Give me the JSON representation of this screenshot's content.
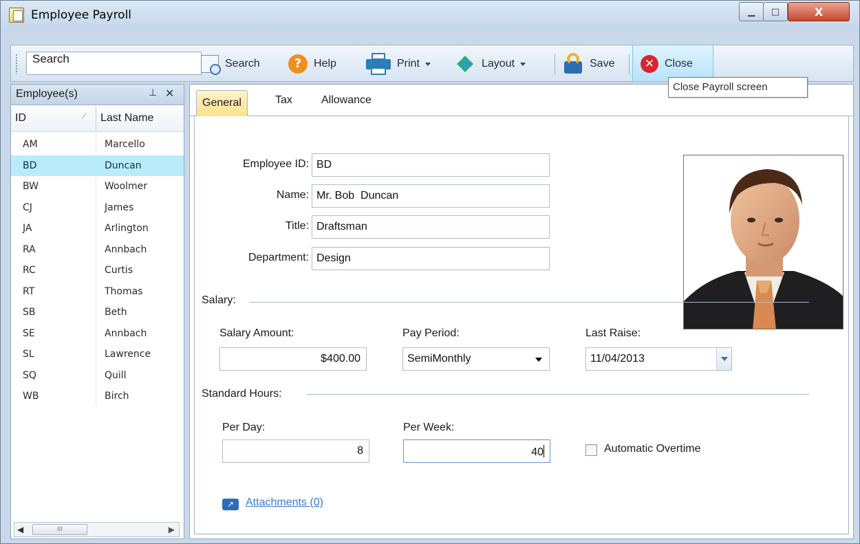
{
  "window": {
    "title": "Employee Payroll",
    "min_glyph": "▁",
    "max_glyph": "□",
    "close_glyph": "X"
  },
  "toolbar": {
    "search_value": "Search",
    "buttons": {
      "search": "Search",
      "help": "Help",
      "print": "Print",
      "layout": "Layout",
      "save": "Save",
      "close": "Close"
    },
    "tooltip": "Close Payroll screen"
  },
  "employees_panel": {
    "title": "Employee(s)",
    "columns": [
      "ID",
      "Last Name"
    ],
    "rows": [
      {
        "id": "AM",
        "last": "Marcello"
      },
      {
        "id": "BD",
        "last": "Duncan"
      },
      {
        "id": "BW",
        "last": "Woolmer"
      },
      {
        "id": "CJ",
        "last": "James"
      },
      {
        "id": "JA",
        "last": "Arlington"
      },
      {
        "id": "RA",
        "last": "Annbach"
      },
      {
        "id": "RC",
        "last": "Curtis"
      },
      {
        "id": "RT",
        "last": "Thomas"
      },
      {
        "id": "SB",
        "last": "Beth"
      },
      {
        "id": "SE",
        "last": "Annbach"
      },
      {
        "id": "SL",
        "last": "Lawrence"
      },
      {
        "id": "SQ",
        "last": "Quill"
      },
      {
        "id": "WB",
        "last": "Birch"
      }
    ],
    "selected_id": "BD"
  },
  "tabs": [
    "General",
    "Tax",
    "Allowance"
  ],
  "active_tab": "General",
  "form": {
    "employee_id_label": "Employee ID:",
    "employee_id": "BD",
    "name_label": "Name:",
    "name": "Mr. Bob  Duncan",
    "title_label": "Title:",
    "title": "Draftsman",
    "department_label": "Department:",
    "department": "Design",
    "salary_group": "Salary:",
    "salary_amount_label": "Salary Amount:",
    "salary_amount": "$400.00",
    "pay_period_label": "Pay Period:",
    "pay_period": "SemiMonthly",
    "last_raise_label": "Last Raise:",
    "last_raise": "11/04/2013",
    "hours_group": "Standard Hours:",
    "per_day_label": "Per Day:",
    "per_day": "8",
    "per_week_label": "Per Week:",
    "per_week": "40",
    "automatic_overtime_label": "Automatic Overtime",
    "automatic_overtime_checked": false,
    "attachments_link": "Attachments (0)"
  },
  "colors": {
    "selected_row": "#b8ecfb",
    "active_tab": "#fde08a",
    "close_highlight": "#b7e3fa",
    "link": "#3a7cc9"
  }
}
